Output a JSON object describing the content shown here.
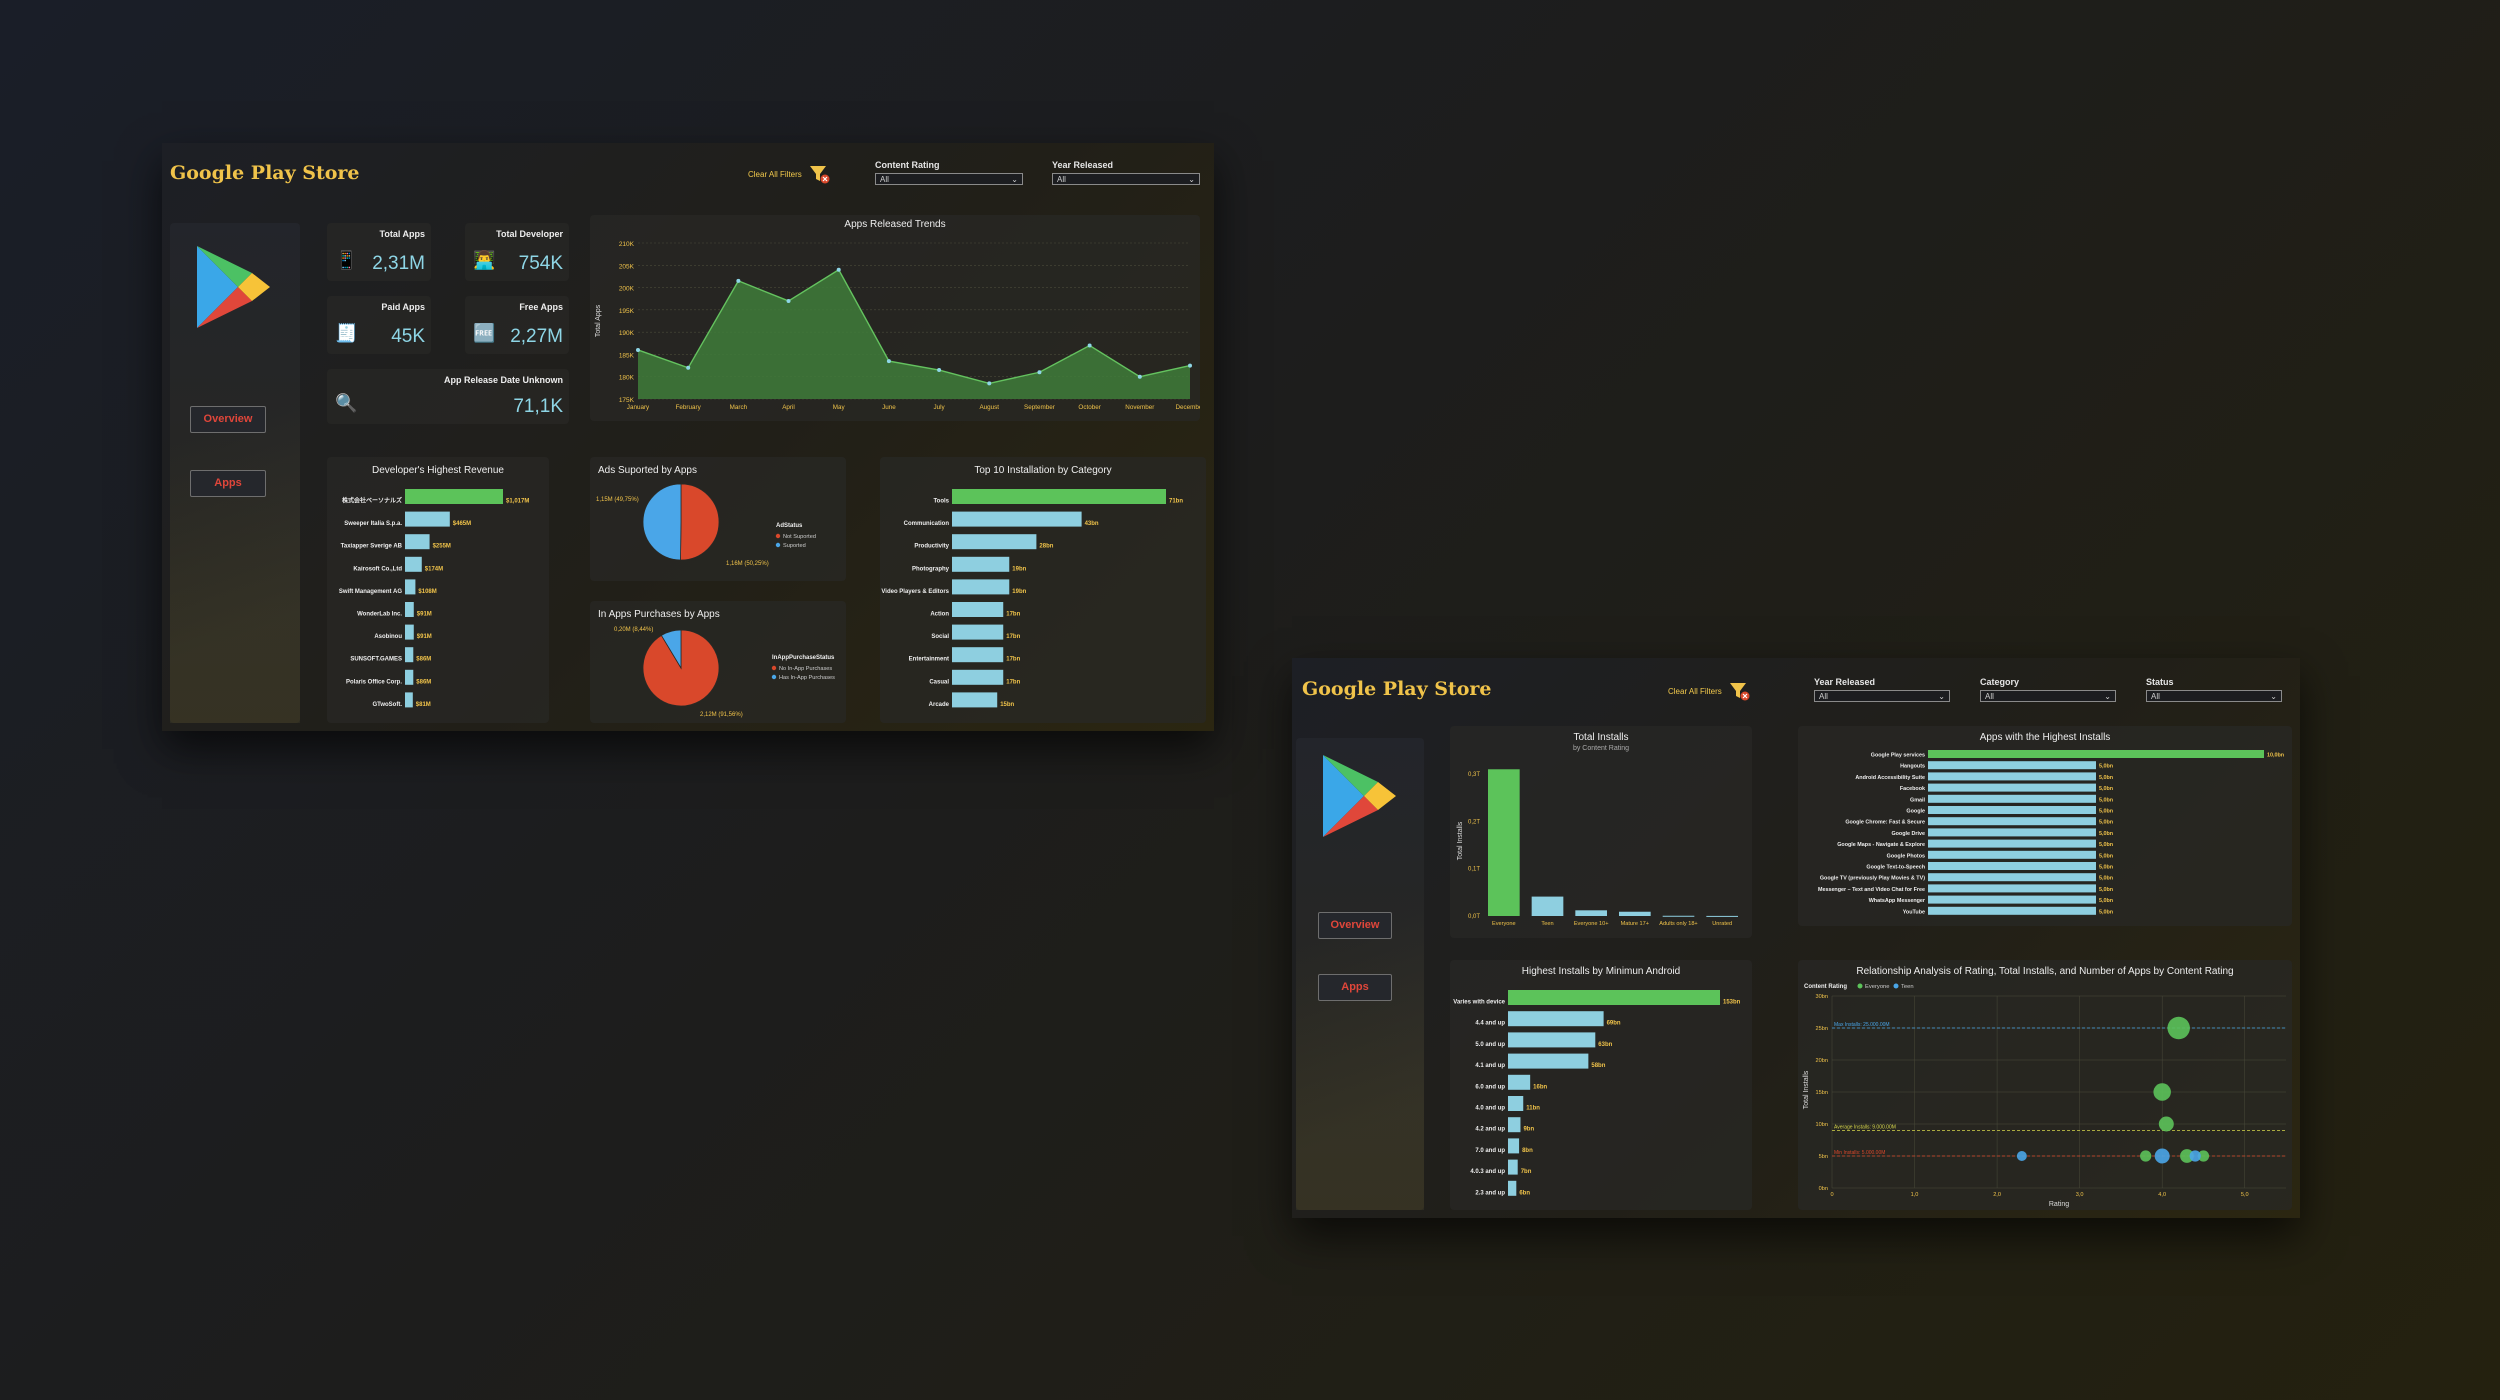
{
  "board1": {
    "title": "Google Play Store",
    "clear_filters": "Clear All Filters",
    "filters": [
      {
        "label": "Content Rating",
        "value": "All"
      },
      {
        "label": "Year Released",
        "value": "All"
      }
    ],
    "nav": {
      "overview": "Overview",
      "apps": "Apps"
    },
    "kpis": {
      "total_apps": {
        "label": "Total Apps",
        "value": "2,31M"
      },
      "total_developer": {
        "label": "Total Developer",
        "value": "754K"
      },
      "paid_apps": {
        "label": "Paid Apps",
        "value": "45K"
      },
      "free_apps": {
        "label": "Free Apps",
        "value": "2,27M"
      },
      "unknown": {
        "label": "App Release Date Unknown",
        "value": "71,1K"
      }
    },
    "charts": {
      "trend": {
        "title": "Apps Released Trends",
        "ylabel": "Total Apps"
      },
      "revenue": {
        "title": "Developer's Highest Revenue"
      },
      "ads": {
        "title": "Ads Suported by Apps",
        "legend_title": "AdStatus"
      },
      "iap": {
        "title": "In Apps Purchases by Apps",
        "legend_title": "InAppPurchaseStatus"
      },
      "top10": {
        "title": "Top 10 Installation by Category"
      }
    }
  },
  "board2": {
    "title": "Google Play Store",
    "clear_filters": "Clear All Filters",
    "filters": [
      {
        "label": "Year Released",
        "value": "All"
      },
      {
        "label": "Category",
        "value": "All"
      },
      {
        "label": "Status",
        "value": "All"
      }
    ],
    "nav": {
      "overview": "Overview",
      "apps": "Apps"
    },
    "charts": {
      "total_installs": {
        "title": "Total Installs",
        "subtitle": "by Content Rating",
        "ylabel": "Total Installs"
      },
      "highest_installs": {
        "title": "Apps with the Highest Installs"
      },
      "min_android": {
        "title": "Highest Installs by Minimun Android"
      },
      "relationship": {
        "title": "Relationship Analysis of Rating, Total Installs, and Number of Apps by Content Rating",
        "legend_title": "Content Rating",
        "xlabel": "Rating",
        "ylabel": "Total Installs",
        "max_line": "Max Installs: 25.000.00M",
        "avg_line": "Average Installs: 9.000.00M",
        "min_line": "Min Installs: 5.000.00M"
      }
    }
  },
  "colors": {
    "green": "#5cc35a",
    "blue": "#8ecfe0",
    "orange": "#d9482b",
    "sky": "#4aa6e8",
    "gold": "#f0c34a"
  },
  "chart_data": [
    {
      "id": "apps-released-trends",
      "type": "area",
      "title": "Apps Released Trends",
      "ylabel": "Total Apps",
      "categories": [
        "January",
        "February",
        "March",
        "April",
        "May",
        "June",
        "July",
        "August",
        "September",
        "October",
        "November",
        "December"
      ],
      "values": [
        186000,
        182000,
        201500,
        197000,
        204000,
        183500,
        181500,
        178500,
        181000,
        187000,
        180000,
        182500
      ],
      "ylim": [
        175000,
        210000
      ],
      "yticks": [
        "175K",
        "180K",
        "185K",
        "190K",
        "195K",
        "200K",
        "205K",
        "210K"
      ]
    },
    {
      "id": "developer-highest-revenue",
      "type": "bar",
      "title": "Developer's Highest Revenue",
      "categories": [
        "株式会社ベーソナルズ",
        "Sweeper Italia S.p.a.",
        "Taxiapper Sverige AB",
        "Kairosoft Co.,Ltd",
        "Swift Management AG",
        "WonderLab Inc.",
        "Asobinou",
        "SUNSOFT.GAMES",
        "Polaris Office Corp.",
        "GTwoSoft."
      ],
      "values": [
        1017,
        465,
        255,
        174,
        108,
        91,
        91,
        86,
        86,
        81
      ],
      "labels": [
        "$1,017M",
        "$465M",
        "$255M",
        "$174M",
        "$108M",
        "$91M",
        "$91M",
        "$86M",
        "$86M",
        "$81M"
      ]
    },
    {
      "id": "ads-supported",
      "type": "pie",
      "title": "Ads Suported by Apps",
      "categories": [
        "Not Suported",
        "Suported"
      ],
      "values": [
        1.16,
        1.15
      ],
      "labels": [
        "1,16M (50,25%)",
        "1,15M (49,75%)"
      ],
      "legend": "right"
    },
    {
      "id": "in-app-purchases",
      "type": "pie",
      "title": "In Apps Purchases by Apps",
      "categories": [
        "No In-App Purchases",
        "Has In-App Purchases"
      ],
      "values": [
        2.12,
        0.2
      ],
      "labels": [
        "2,12M (91,56%)",
        "0,20M (8,44%)"
      ],
      "legend": "right"
    },
    {
      "id": "top10-installation",
      "type": "bar",
      "title": "Top 10 Installation by Category",
      "categories": [
        "Tools",
        "Communication",
        "Productivity",
        "Photography",
        "Video Players & Editors",
        "Action",
        "Social",
        "Entertainment",
        "Casual",
        "Arcade"
      ],
      "values": [
        71,
        43,
        28,
        19,
        19,
        17,
        17,
        17,
        17,
        15
      ],
      "labels": [
        "71bn",
        "43bn",
        "28bn",
        "19bn",
        "19bn",
        "17bn",
        "17bn",
        "17bn",
        "17bn",
        "15bn"
      ]
    },
    {
      "id": "total-installs-by-content-rating",
      "type": "bar",
      "title": "Total Installs",
      "subtitle": "by Content Rating",
      "ylabel": "Total Installs",
      "categories": [
        "Everyone",
        "Teen",
        "Everyone 10+",
        "Mature 17+",
        "Adults only 18+",
        "Unrated"
      ],
      "values": [
        0.31,
        0.041,
        0.012,
        0.009,
        0.0005,
        0.0002
      ],
      "yticks": [
        "0,0T",
        "0,1T",
        "0,2T",
        "0,3T"
      ],
      "ylim": [
        0,
        0.3
      ]
    },
    {
      "id": "apps-highest-installs",
      "type": "bar",
      "title": "Apps with the Highest Installs",
      "categories": [
        "Google Play services",
        "Hangouts",
        "Android Accessibility Suite",
        "Facebook",
        "Gmail",
        "Google",
        "Google Chrome: Fast & Secure",
        "Google Drive",
        "Google Maps - Navigate & Explore",
        "Google Photos",
        "Google Text-to-Speech",
        "Google TV (previously Play Movies & TV)",
        "Messenger – Text and Video Chat for Free",
        "WhatsApp Messenger",
        "YouTube"
      ],
      "values": [
        10.0,
        5.0,
        5.0,
        5.0,
        5.0,
        5.0,
        5.0,
        5.0,
        5.0,
        5.0,
        5.0,
        5.0,
        5.0,
        5.0,
        5.0
      ],
      "labels": [
        "10,0bn",
        "5,0bn",
        "5,0bn",
        "5,0bn",
        "5,0bn",
        "5,0bn",
        "5,0bn",
        "5,0bn",
        "5,0bn",
        "5,0bn",
        "5,0bn",
        "5,0bn",
        "5,0bn",
        "5,0bn",
        "5,0bn"
      ]
    },
    {
      "id": "installs-by-min-android",
      "type": "bar",
      "title": "Highest Installs by Minimun Android",
      "categories": [
        "Varies with device",
        "4.4 and up",
        "5.0 and up",
        "4.1 and up",
        "6.0 and up",
        "4.0 and up",
        "4.2 and up",
        "7.0 and up",
        "4.0.3 and up",
        "2.3 and up"
      ],
      "values": [
        153,
        69,
        63,
        58,
        16,
        11,
        9,
        8,
        7,
        6
      ],
      "labels": [
        "153bn",
        "69bn",
        "63bn",
        "58bn",
        "16bn",
        "11bn",
        "9bn",
        "8bn",
        "7bn",
        "6bn"
      ]
    },
    {
      "id": "rating-vs-installs",
      "type": "scatter",
      "title": "Relationship Analysis of Rating, Total Installs, and Number of Apps by Content Rating",
      "xlabel": "Rating",
      "ylabel": "Total Installs",
      "xlim": [
        0,
        5.5
      ],
      "ylim": [
        0,
        30
      ],
      "xticks": [
        "0",
        "1,0",
        "2,0",
        "3,0",
        "4,0",
        "5,0"
      ],
      "yticks": [
        "0bn",
        "5bn",
        "10bn",
        "15bn",
        "20bn",
        "25bn",
        "30bn"
      ],
      "series": [
        {
          "name": "Everyone",
          "points": [
            {
              "x": 4.2,
              "y": 25,
              "size": 18
            },
            {
              "x": 4.0,
              "y": 15,
              "size": 14
            },
            {
              "x": 4.05,
              "y": 10,
              "size": 12
            },
            {
              "x": 3.8,
              "y": 5,
              "size": 9
            },
            {
              "x": 4.3,
              "y": 5,
              "size": 11
            },
            {
              "x": 4.5,
              "y": 5,
              "size": 9
            }
          ]
        },
        {
          "name": "Teen",
          "points": [
            {
              "x": 2.3,
              "y": 5,
              "size": 8
            },
            {
              "x": 4.0,
              "y": 5,
              "size": 12
            },
            {
              "x": 4.4,
              "y": 5,
              "size": 9
            }
          ]
        }
      ],
      "reference_lines": [
        {
          "label": "Max Installs: 25.000.00M",
          "y": 25
        },
        {
          "label": "Average Installs: 9.000.00M",
          "y": 9
        },
        {
          "label": "Min Installs: 5.000.00M",
          "y": 5
        }
      ],
      "legend": "top-left"
    }
  ]
}
